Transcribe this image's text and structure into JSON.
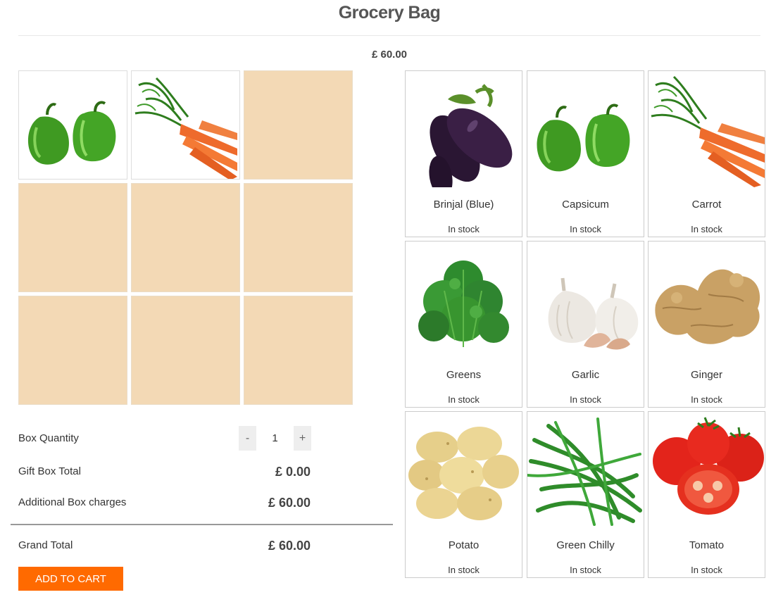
{
  "page": {
    "title": "Grocery Bag",
    "price": "£ 60.00"
  },
  "box": {
    "slots": [
      {
        "filled": true,
        "item": "capsicum"
      },
      {
        "filled": true,
        "item": "carrot"
      },
      {
        "filled": false
      },
      {
        "filled": false
      },
      {
        "filled": false
      },
      {
        "filled": false
      },
      {
        "filled": false
      },
      {
        "filled": false
      },
      {
        "filled": false
      }
    ]
  },
  "summary": {
    "quantity_label": "Box Quantity",
    "minus": "-",
    "quantity_value": "1",
    "plus": "+",
    "gift_box_label": "Gift Box Total",
    "gift_box_value": "£ 0.00",
    "additional_label": "Additional Box charges",
    "additional_value": "£ 60.00",
    "grand_total_label": "Grand Total",
    "grand_total_value": "£ 60.00",
    "add_to_cart": "ADD TO CART"
  },
  "products": [
    {
      "name": "Brinjal (Blue)",
      "stock": "In stock",
      "icon": "brinjal-image"
    },
    {
      "name": "Capsicum",
      "stock": "In stock",
      "icon": "capsicum-image"
    },
    {
      "name": "Carrot",
      "stock": "In stock",
      "icon": "carrot-image"
    },
    {
      "name": "Greens",
      "stock": "In stock",
      "icon": "greens-image"
    },
    {
      "name": "Garlic",
      "stock": "In stock",
      "icon": "garlic-image"
    },
    {
      "name": "Ginger",
      "stock": "In stock",
      "icon": "ginger-image"
    },
    {
      "name": "Potato",
      "stock": "In stock",
      "icon": "potato-image"
    },
    {
      "name": "Green Chilly",
      "stock": "In stock",
      "icon": "green-chilly-image"
    },
    {
      "name": "Tomato",
      "stock": "In stock",
      "icon": "tomato-image"
    }
  ],
  "colors": {
    "accent": "#ff6a00",
    "slot_empty": "#f3d9b5"
  }
}
